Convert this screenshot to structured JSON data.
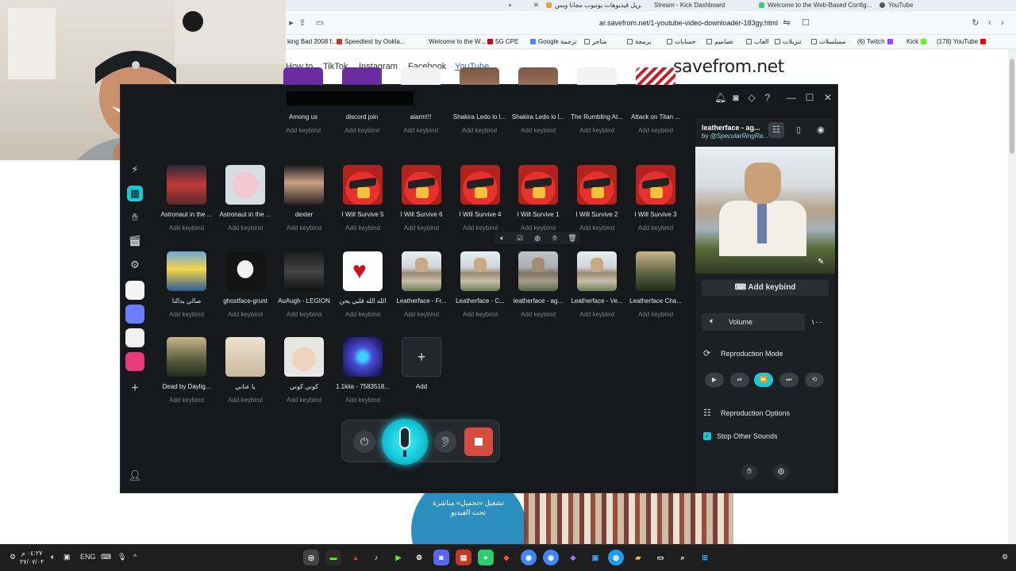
{
  "browser": {
    "tabs": [
      {
        "label": "تنزيل فيديوهات يوتيوب مجاناً وبس...",
        "color": "#e8a23a"
      },
      {
        "label": "Stream - Kick Dashboard",
        "color": "#3ad16b"
      },
      {
        "label": "Welcome to the Web-Based Config...",
        "color": "#555555"
      },
      {
        "label": "YouTube",
        "color": "#ff0000"
      }
    ],
    "url": "ar.savefrom.net/1-youtube-video-downloader-183gy.html",
    "bookmarks": [
      {
        "label": "king Bad 2008 f...",
        "color": "#c0392b"
      },
      {
        "label": "Speedtest by Ookla...",
        "color": "#222222"
      },
      {
        "label": ":Welcome to the W...",
        "color": "#999999"
      },
      {
        "label": "5G CPE",
        "color": "#d0021b"
      },
      {
        "label": "Google ترجمة",
        "color": "#4a8af4"
      },
      {
        "label": "متاجر",
        "color": "#666666"
      },
      {
        "label": "برمجة",
        "color": "#666666"
      },
      {
        "label": "حسابات",
        "color": "#666666"
      },
      {
        "label": "تصاميم",
        "color": "#666666"
      },
      {
        "label": "العاب",
        "color": "#666666"
      },
      {
        "label": "تنزيلات",
        "color": "#666666"
      },
      {
        "label": "مسلسلات",
        "color": "#666666"
      },
      {
        "label": "(6) Twitch",
        "color": "#9146ff"
      },
      {
        "label": "Kick",
        "color": "#53fc18"
      },
      {
        "label": "(178) YouTube",
        "color": "#ff0000"
      }
    ]
  },
  "site": {
    "nav": [
      "How to",
      "TikTok",
      "Instagram",
      "Facebook",
      "YouTube"
    ],
    "logo": "savefrom.net",
    "promo_text": "تشغيل «تحميل» مباشرة تحت الفيديو"
  },
  "app": {
    "top_row": [
      {
        "title": "Among us",
        "key": "Add keybind",
        "art": "art-among"
      },
      {
        "title": "discord join",
        "key": "Add keybind",
        "art": "art-among"
      },
      {
        "title": "alarm!!!",
        "key": "Add keybind",
        "art": "art-white"
      },
      {
        "title": "Shakira Ledo lo l...",
        "key": "Add keybind",
        "art": "art-top"
      },
      {
        "title": "Shakira Ledo lo l...",
        "key": "Add keybind",
        "art": "art-top"
      },
      {
        "title": "The Rumbling At...",
        "key": "Add keybind",
        "art": "art-white"
      },
      {
        "title": "Attack on Titan ...",
        "key": "Add keybind",
        "art": "art-stripe"
      }
    ],
    "row2": [
      {
        "title": "Astronaut in the ...",
        "key": "Add keybind",
        "art": "art-red-face"
      },
      {
        "title": "Astronaut in the ...",
        "key": "Add keybind",
        "art": "art-pink"
      },
      {
        "title": "dexter",
        "key": "Add keybind",
        "art": "art-dexter"
      },
      {
        "title": "I Will Survive 5",
        "key": "Add keybind",
        "art": "art-bird"
      },
      {
        "title": "I Will Survive 6",
        "key": "Add keybind",
        "art": "art-bird"
      },
      {
        "title": "I Will Survive 4",
        "key": "Add keybind",
        "art": "art-bird"
      },
      {
        "title": "I Will Survive 1",
        "key": "Add keybind",
        "art": "art-bird"
      },
      {
        "title": "I Will Survive 2",
        "key": "Add keybind",
        "art": "art-bird"
      },
      {
        "title": "I Will Survive 3",
        "key": "Add keybind",
        "art": "art-bird"
      }
    ],
    "row3": [
      {
        "title": "صالي بدالنا",
        "key": "Add keybind",
        "art": "art-simpsons"
      },
      {
        "title": "ghostface-grunt",
        "key": "Add keybind",
        "art": "art-scream"
      },
      {
        "title": "AuAugh - LEGION",
        "key": "Add keybind",
        "art": "art-dark"
      },
      {
        "title": "الله الله قلبي يحن",
        "key": "Add keybind",
        "art": "art-heart"
      },
      {
        "title": "Leatherface - Fr...",
        "key": "Add keybind",
        "art": "art-leather"
      },
      {
        "title": "Leatherface - C...",
        "key": "Add keybind",
        "art": "art-leather"
      },
      {
        "title": "leatherface - ag...",
        "key": "Add keybind",
        "art": "art-leather"
      },
      {
        "title": "Leatherface - Ve...",
        "key": "Add keybind",
        "art": "art-leather"
      },
      {
        "title": "Leatherface Cha...",
        "key": "Add keybind",
        "art": "art-dead"
      }
    ],
    "row4": [
      {
        "title": "Dead by Daylig...",
        "key": "Add keybind",
        "art": "art-dead"
      },
      {
        "title": "يا عناني",
        "key": "Add keybind",
        "art": "art-cat"
      },
      {
        "title": "كوني كوني",
        "key": "Add keybind",
        "art": "art-baby"
      },
      {
        "title": "1.1kiia - 7583518...",
        "key": "Add keybind",
        "art": "art-wave"
      }
    ],
    "add_label": "Add",
    "add_symbol": "+",
    "panel": {
      "title": "leatherface - ag...",
      "by_prefix": "by",
      "by": "@SpecularRingRa...",
      "add_keybind": "Add keybind",
      "volume_label": "Volume",
      "volume_value": "١٠٠",
      "mode_label": "Reproduction Mode",
      "options_label": "Reproduction Options",
      "stop_label": "Stop Other Sounds"
    }
  },
  "taskbar": {
    "time": "٠٤:٢٧ م",
    "date": "٢٧/٠٧/٠٢",
    "lang": "ENG"
  },
  "colors": {
    "accent": "#1bc8d8",
    "stop": "#d64c3f",
    "app_bg": "#16181c"
  }
}
